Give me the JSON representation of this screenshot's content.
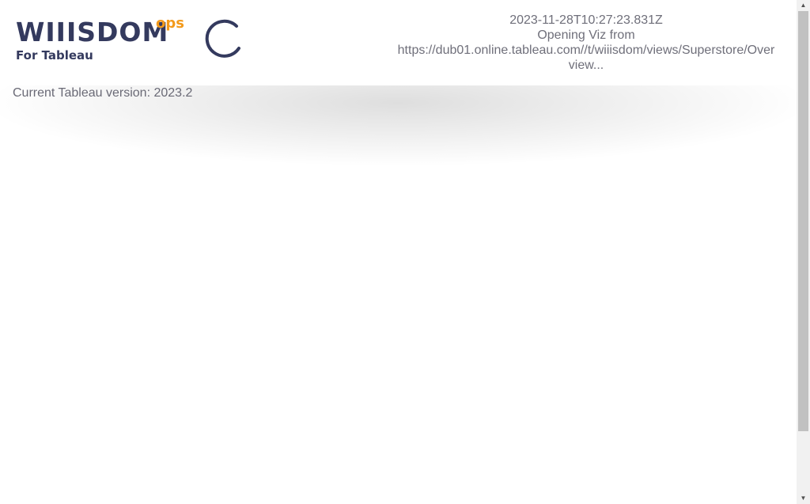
{
  "header": {
    "logo": {
      "brand": "WIIISDOM",
      "ops": "ops",
      "subtitle": "For Tableau"
    },
    "spinner_icon": "loading-spinner-icon",
    "status": {
      "timestamp": "2023-11-28T10:27:23.831Z",
      "line1": "Opening Viz from",
      "line2": "https://dub01.online.tableau.com//t/wiiisdom/views/Superstore/Over",
      "line3": "view..."
    }
  },
  "main": {
    "version_label": "Current Tableau version: 2023.2"
  },
  "scrollbar": {
    "up_icon": "▲",
    "down_icon": "▼"
  },
  "colors": {
    "brand_navy": "#343a5e",
    "brand_orange": "#f39a1b",
    "text_gray": "#6f6f7a"
  }
}
